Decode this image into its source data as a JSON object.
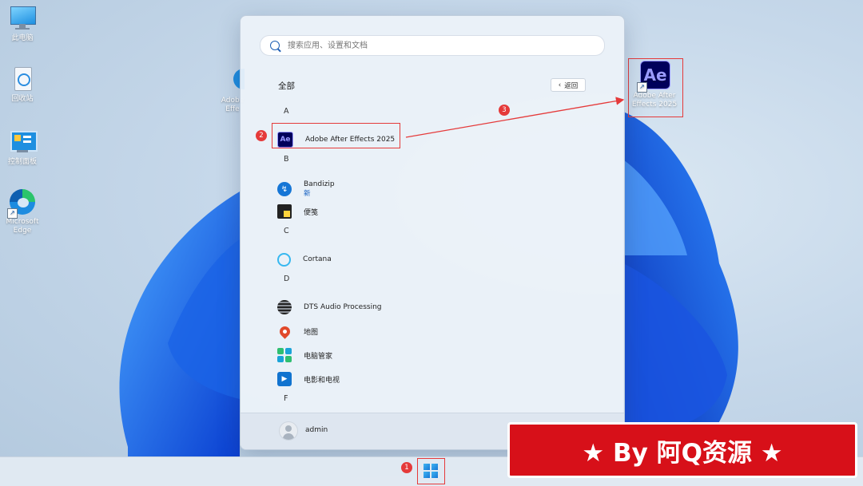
{
  "desktop": {
    "icons": [
      {
        "label": "此电脑"
      },
      {
        "label": "回收站"
      },
      {
        "label": "控制面板"
      },
      {
        "label": "Microsoft Edge"
      }
    ],
    "ae_shortcut_label": "Adobe After Effects 2025",
    "partial_label": "Adobe Effe"
  },
  "start_menu": {
    "search_placeholder": "搜索应用、设置和文档",
    "section_title": "全部",
    "back_label": "返回",
    "groups": [
      {
        "letter": "A",
        "apps": [
          {
            "name": "Adobe After Effects 2025",
            "icon": "after-effects-icon"
          }
        ]
      },
      {
        "letter": "B",
        "apps": [
          {
            "name": "Bandizip",
            "sub": "新",
            "icon": "bandizip-icon"
          },
          {
            "name": "便笺",
            "icon": "sticky-notes-icon"
          }
        ]
      },
      {
        "letter": "C",
        "apps": [
          {
            "name": "Cortana",
            "icon": "cortana-icon"
          }
        ]
      },
      {
        "letter": "D",
        "apps": [
          {
            "name": "DTS Audio Processing",
            "icon": "dts-icon"
          },
          {
            "name": "地图",
            "icon": "maps-icon"
          },
          {
            "name": "电脑管家",
            "icon": "pc-manager-icon"
          },
          {
            "name": "电影和电视",
            "icon": "movies-tv-icon"
          }
        ]
      },
      {
        "letter": "F",
        "apps": []
      }
    ],
    "user": "admin"
  },
  "annotations": {
    "step1": "1",
    "step2": "2",
    "step3": "3"
  },
  "banner": {
    "text": "★ By 阿Q资源 ★"
  },
  "colors": {
    "annotation_red": "#e53a3a",
    "banner_red": "#d71019",
    "ae_purple": "#00005b",
    "ae_text": "#9999ff"
  }
}
